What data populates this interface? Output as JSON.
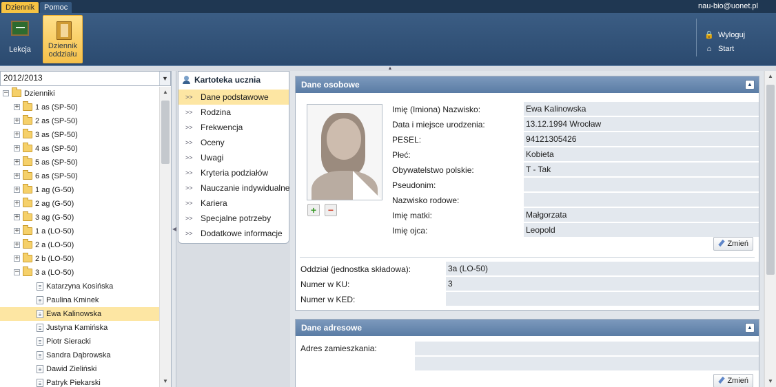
{
  "topbar": {
    "tabs": [
      "Dziennik",
      "Pomoc"
    ],
    "user_email": "nau-bio@uonet.pl"
  },
  "ribbon": {
    "lekcja": "Lekcja",
    "dziennik_line1": "Dziennik",
    "dziennik_line2": "oddziału",
    "wyloguj": "Wyloguj",
    "start": "Start"
  },
  "left": {
    "year": "2012/2013",
    "root": "Dzienniki",
    "classes": [
      "1 as (SP-50)",
      "2 as (SP-50)",
      "3 as (SP-50)",
      "4 as (SP-50)",
      "5 as (SP-50)",
      "6 as (SP-50)",
      "1 ag (G-50)",
      "2 ag (G-50)",
      "3 ag (G-50)",
      "1 a (LO-50)",
      "2 a (LO-50)",
      "2 b (LO-50)",
      "3 a (LO-50)"
    ],
    "students": [
      "Katarzyna Kosińska",
      "Paulina Kminek",
      "Ewa Kalinowska",
      "Justyna Kamińska",
      "Piotr Sieracki",
      "Sandra Dąbrowska",
      "Dawid Zieliński",
      "Patryk Piekarski"
    ],
    "selected_student": "Ewa Kalinowska"
  },
  "nav": {
    "title": "Kartoteka ucznia",
    "items": [
      "Dane podstawowe",
      "Rodzina",
      "Frekwencja",
      "Oceny",
      "Uwagi",
      "Kryteria podziałów",
      "Nauczanie indywidualne",
      "Kariera",
      "Specjalne potrzeby",
      "Dodatkowe informacje"
    ],
    "active": "Dane podstawowe"
  },
  "osobowe": {
    "title": "Dane osobowe",
    "fields": [
      {
        "label": "Imię (Imiona) Nazwisko:",
        "value": "Ewa Kalinowska"
      },
      {
        "label": "Data i miejsce urodzenia:",
        "value": "13.12.1994 Wrocław"
      },
      {
        "label": "PESEL:",
        "value": "94121305426"
      },
      {
        "label": "Płeć:",
        "value": "Kobieta"
      },
      {
        "label": "Obywatelstwo polskie:",
        "value": "T - Tak"
      },
      {
        "label": "Pseudonim:",
        "value": ""
      },
      {
        "label": "Nazwisko rodowe:",
        "value": ""
      },
      {
        "label": "Imię matki:",
        "value": "Małgorzata"
      },
      {
        "label": "Imię ojca:",
        "value": "Leopold"
      }
    ],
    "zmien": "Zmień",
    "class_fields": [
      {
        "label": "Oddział (jednostka składowa):",
        "value": "3a (LO-50)"
      },
      {
        "label": "Numer w KU:",
        "value": "3"
      },
      {
        "label": "Numer w KED:",
        "value": ""
      }
    ]
  },
  "adresowe": {
    "title": "Dane adresowe",
    "label": "Adres zamieszkania:",
    "line1": "",
    "line2": "",
    "zmien": "Zmień"
  },
  "icons": {
    "lekcja": "blackboard-icon",
    "dziennik": "book-icon",
    "wyloguj": "lock-icon",
    "start": "home-icon",
    "add": "plus-icon",
    "remove": "minus-icon",
    "edit": "pencil-icon"
  },
  "colors": {
    "topbar": "#1f3752",
    "accent": "#f6c343",
    "selection": "#fde6a3",
    "section_header": "#6a8ab2"
  }
}
